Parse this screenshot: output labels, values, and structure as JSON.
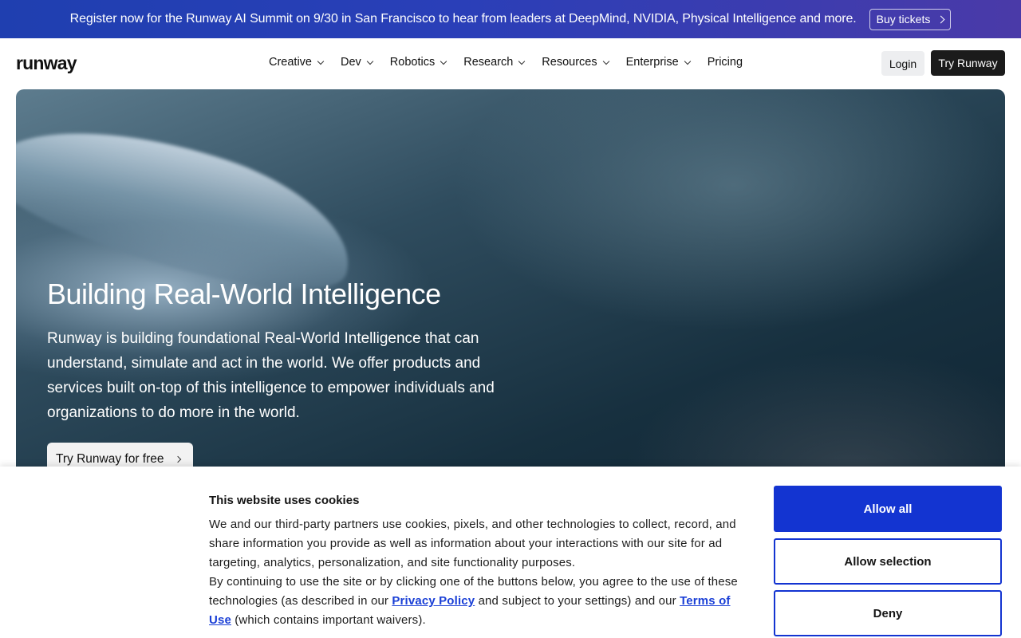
{
  "banner": {
    "text": "Register now for the Runway AI Summit on 9/30 in San Francisco to hear from leaders at DeepMind, NVIDIA, Physical Intelligence and more.",
    "button_label": "Buy tickets"
  },
  "nav": {
    "logo": "runway",
    "items": [
      {
        "label": "Creative",
        "has_dropdown": true
      },
      {
        "label": "Dev",
        "has_dropdown": true
      },
      {
        "label": "Robotics",
        "has_dropdown": true
      },
      {
        "label": "Research",
        "has_dropdown": true
      },
      {
        "label": "Resources",
        "has_dropdown": true
      },
      {
        "label": "Enterprise",
        "has_dropdown": true
      },
      {
        "label": "Pricing",
        "has_dropdown": false
      }
    ],
    "login_label": "Login",
    "try_label": "Try Runway"
  },
  "hero": {
    "title": "Building Real-World Intelligence",
    "description": "Runway is building foundational Real-World Intelligence that can understand, simulate and act in the world. We offer products and services built on-top of this intelligence to empower individuals and organizations to do more in the world.",
    "cta_label": "Try Runway for free"
  },
  "cookie": {
    "title": "This website uses cookies",
    "para1": "We and our third-party partners use cookies, pixels, and other technologies to collect, record, and share information you provide as well as information about your interactions with our site for ad targeting, analytics, personalization, and site functionality purposes.",
    "para2_a": "By continuing to use the site or by clicking one of the buttons below, you agree to the use of these technologies (as described in our ",
    "privacy_link": "Privacy Policy",
    "para2_b": " and subject to your settings) and our ",
    "terms_link": "Terms of Use",
    "para2_c": " (which contains important waivers).",
    "allow_all": "Allow all",
    "allow_selection": "Allow selection",
    "deny": "Deny"
  },
  "colors": {
    "accent_blue": "#1334d1",
    "link_blue": "#1a3fd6",
    "banner_start": "#1f3fb0",
    "banner_end": "#4a3aa8",
    "dark_button": "#1b1b1b"
  }
}
